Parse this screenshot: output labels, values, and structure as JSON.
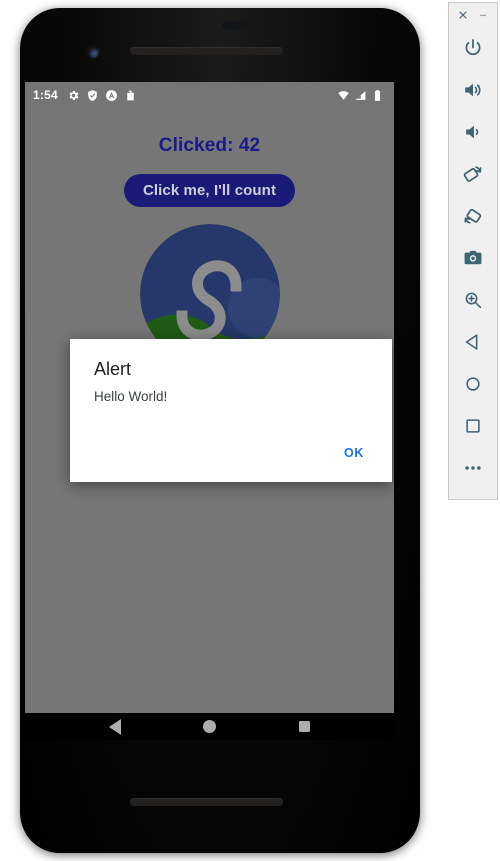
{
  "device": {
    "name": "android-phone-emulator",
    "frame_color": "#050505"
  },
  "status_bar": {
    "time": "1:54",
    "left_icons": [
      "gear-icon",
      "shield-icon",
      "circled-a-icon",
      "bag-lock-icon"
    ],
    "right_icons": [
      "wifi-icon",
      "cellular-signal-icon",
      "battery-icon"
    ],
    "background": "#757575",
    "text_color": "#ffffff"
  },
  "app": {
    "background": "#767676",
    "counter_label": "Clicked: 42",
    "counter_color": "#1a1a8c",
    "button_label": "Click me, I'll count",
    "button_bg": "#1a1a78",
    "button_text_color": "#cfcfd4",
    "logo": {
      "name": "app-logo",
      "sky_color": "#26386b",
      "hill_color": "#1f5c15",
      "letter_color": "#8c8c8c",
      "letter": "S"
    }
  },
  "dialog": {
    "title": "Alert",
    "message": "Hello World!",
    "ok_label": "OK",
    "ok_color": "#1a73e8",
    "background": "#ffffff"
  },
  "nav_bar": {
    "background": "#000000",
    "icon_color": "#adadad",
    "buttons": [
      {
        "name": "nav-back-button",
        "icon": "triangle-back-icon"
      },
      {
        "name": "nav-home-button",
        "icon": "circle-home-icon"
      },
      {
        "name": "nav-recents-button",
        "icon": "square-recents-icon"
      }
    ]
  },
  "emulator_toolbar": {
    "background": "#f0f0f0",
    "icon_color": "#3d6475",
    "window_controls": [
      {
        "name": "close-window-button",
        "icon": "close-icon",
        "glyph": "×"
      },
      {
        "name": "minimize-window-button",
        "icon": "minimize-icon",
        "glyph": "−"
      }
    ],
    "buttons": [
      {
        "name": "power-button",
        "icon": "power-icon"
      },
      {
        "name": "volume-up-button",
        "icon": "volume-up-icon"
      },
      {
        "name": "volume-down-button",
        "icon": "volume-down-icon"
      },
      {
        "name": "rotate-left-button",
        "icon": "rotate-left-icon"
      },
      {
        "name": "rotate-right-button",
        "icon": "rotate-right-icon"
      },
      {
        "name": "screenshot-button",
        "icon": "camera-icon"
      },
      {
        "name": "zoom-button",
        "icon": "magnifier-plus-icon"
      },
      {
        "name": "back-button",
        "icon": "triangle-back-icon"
      },
      {
        "name": "home-button",
        "icon": "circle-home-icon"
      },
      {
        "name": "overview-button",
        "icon": "square-overview-icon"
      },
      {
        "name": "more-button",
        "icon": "ellipsis-icon"
      }
    ]
  }
}
